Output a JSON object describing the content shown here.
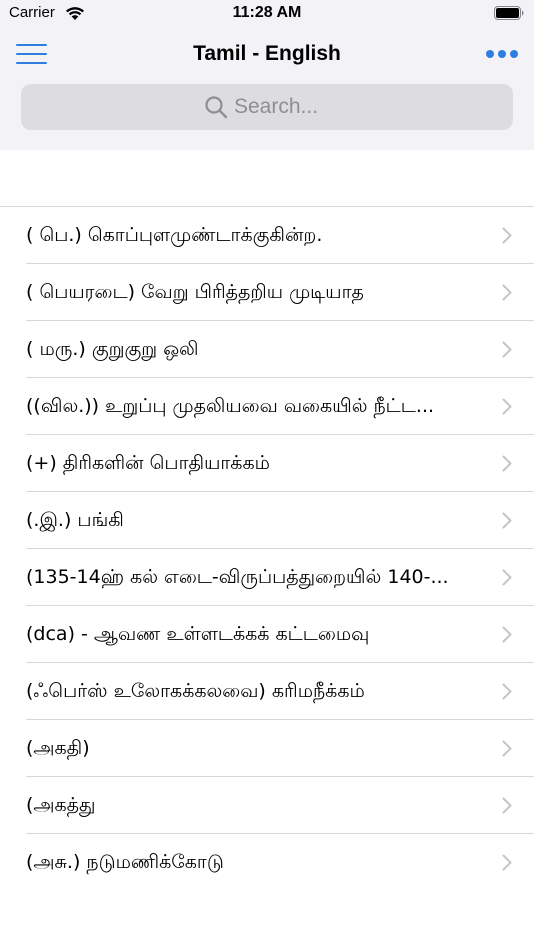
{
  "status_bar": {
    "carrier": "Carrier",
    "time": "11:28 AM"
  },
  "nav": {
    "title": "Tamil - English",
    "menu_icon": "hamburger-menu-icon",
    "more_icon": "ellipsis-more-icon",
    "accent_color": "#2f7de1"
  },
  "search": {
    "placeholder": "Search...",
    "value": ""
  },
  "entries": [
    {
      "label": "( பெ.) கொப்புளமுண்டாக்குகின்ற."
    },
    {
      "label": "( பெயரடை) வேறு பிரித்தறிய முடியாத"
    },
    {
      "label": "( மரு.) குறுகுறு ஒலி"
    },
    {
      "label": "((வில.)) உறுப்பு முதலியவை வகையில் நீட்ட..."
    },
    {
      "label": "(+) திரிகளின் பொதியாக்கம்"
    },
    {
      "label": "(.இ.) பங்கி"
    },
    {
      "label": "(135-14ஹ் கல் எடை-விருப்பத்துறையில் 140-..."
    },
    {
      "label": "(dca) - ஆவண உள்ளடக்கக் கட்டமைவு"
    },
    {
      "label": "(ஃபெர்ஸ் உலோகக்கலவை) கரிமநீக்கம்"
    },
    {
      "label": "(அகதி)"
    },
    {
      "label": "(அகத்து"
    },
    {
      "label": "(அசு.) நடுமணிக்கோடு"
    }
  ]
}
